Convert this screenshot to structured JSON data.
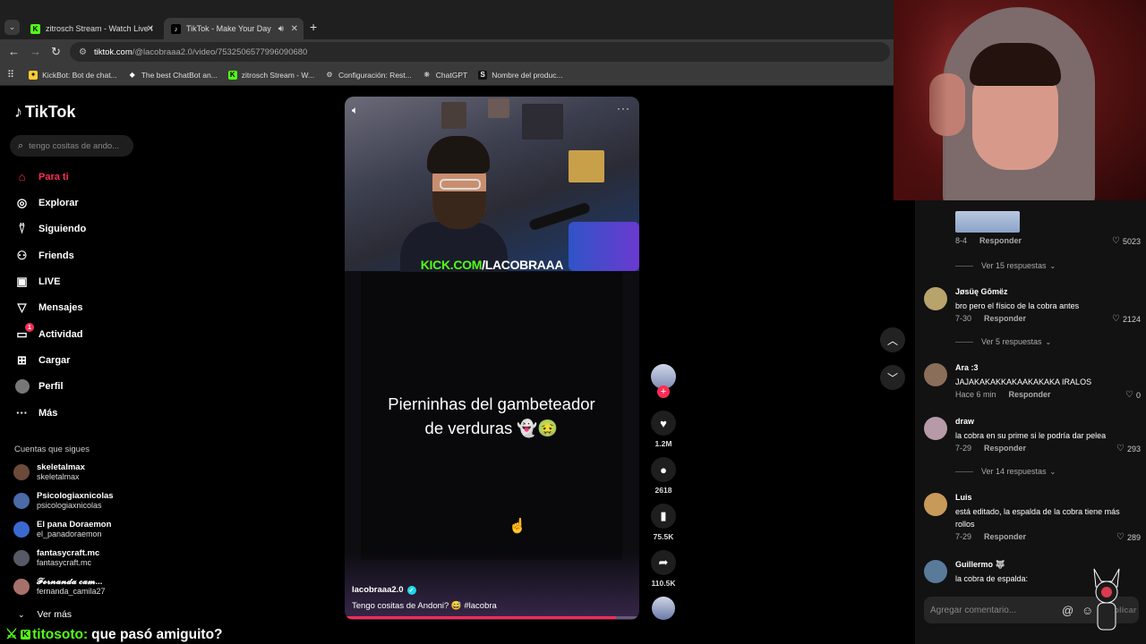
{
  "browser": {
    "tabs": [
      {
        "title": "zitrosch Stream - Watch Live on",
        "favicon": "kick-icon",
        "color": "#53fc18"
      },
      {
        "title": "TikTok - Make Your Day",
        "favicon": "tiktok-icon"
      }
    ],
    "url_host": "tiktok.com",
    "url_path": "/@lacobraaa2.0/video/7532506577996090680",
    "bookmarks": [
      {
        "label": "KickBot: Bot de chat...",
        "icon": "kickbot-icon"
      },
      {
        "label": "The best ChatBot an...",
        "icon": "chatbot-icon"
      },
      {
        "label": "zitrosch Stream - W...",
        "icon": "kick-icon"
      },
      {
        "label": "Configuración: Rest...",
        "icon": "gear-icon"
      },
      {
        "label": "ChatGPT",
        "icon": "chatgpt-icon"
      },
      {
        "label": "Nombre del produc...",
        "icon": "s-icon"
      }
    ]
  },
  "sidebar": {
    "logo": "TikTok",
    "search_placeholder": "tengo cositas de ando...",
    "nav": [
      {
        "label": "Para ti",
        "icon": "home-icon",
        "active": true
      },
      {
        "label": "Explorar",
        "icon": "compass-icon"
      },
      {
        "label": "Siguiendo",
        "icon": "following-icon"
      },
      {
        "label": "Friends",
        "icon": "friends-icon"
      },
      {
        "label": "LIVE",
        "icon": "live-icon"
      },
      {
        "label": "Mensajes",
        "icon": "messages-icon"
      },
      {
        "label": "Actividad",
        "icon": "activity-icon",
        "badge": "1"
      },
      {
        "label": "Cargar",
        "icon": "upload-icon"
      },
      {
        "label": "Perfil",
        "icon": "profile-icon"
      },
      {
        "label": "Más",
        "icon": "more-icon"
      }
    ],
    "following_header": "Cuentas que sigues",
    "following": [
      {
        "name": "skeletalmax",
        "handle": "skeletalmax",
        "color": "#6b4a3a"
      },
      {
        "name": "Psicologiaxnicolas",
        "handle": "psicologiaxnicolas",
        "color": "#4a6aa8"
      },
      {
        "name": "El pana Doraemon",
        "handle": "el_panadoraemon",
        "color": "#3a6ad0"
      },
      {
        "name": "fantasycraft.mc",
        "handle": "fantasycraft.mc",
        "color": "#555a66"
      },
      {
        "name": "𝓕𝓮𝓻𝓷𝓪𝓷𝓭𝓪 𝓬𝓪𝓶...",
        "handle": "fernanda_camila27",
        "color": "#a8706a"
      }
    ],
    "see_more": "Ver más"
  },
  "chat_overlay": {
    "badge": "K",
    "user": "titosoto:",
    "message": "que pasó amiguito?"
  },
  "video": {
    "banner_prefix": "KICK.COM",
    "banner_suffix": "/LACOBRAAA",
    "overlay_text_line1": "Pierninhas del gambeteador",
    "overlay_text_line2": "de verduras 👻🤢",
    "author": "lacobraaa2.0",
    "caption": "Tengo cositas de Andoni? 😅 #lacobra",
    "progress": 0.92,
    "likes": "1.2M",
    "comments": "2618",
    "saves": "75.5K",
    "shares": "110.5K"
  },
  "comments": [
    {
      "name": "",
      "text": "",
      "date": "8-4",
      "reply": "Responder",
      "likes": "5023",
      "replies": "Ver 15 respuestas",
      "color": "#8aa3c9"
    },
    {
      "name": "Jøsüę Gōmëz",
      "text": "bro pero el físico de la cobra antes",
      "date": "7-30",
      "reply": "Responder",
      "likes": "2124",
      "replies": "Ver 5 respuestas",
      "color": "#b8a36a"
    },
    {
      "name": "Ara :3",
      "text": "JAJAKAKAKKAKAAKAKAKA IRALOS",
      "date": "Hace 6 min",
      "reply": "Responder",
      "likes": "0",
      "replies": "",
      "color": "#8a6e5a"
    },
    {
      "name": "draw",
      "text": "la cobra en su prime si le podría dar pelea",
      "date": "7-29",
      "reply": "Responder",
      "likes": "293",
      "replies": "Ver 14 respuestas",
      "color": "#b79aa8"
    },
    {
      "name": "Luis",
      "text": "está editado, la espalda de la cobra tiene más rollos",
      "date": "7-29",
      "reply": "Responder",
      "likes": "289",
      "replies": "",
      "color": "#c89a5a"
    },
    {
      "name": "Guillermo 🐺",
      "text": "la cobra de espalda:",
      "date": "",
      "reply": "",
      "likes": "",
      "replies": "",
      "color": "#5a7a9a"
    }
  ],
  "comment_input_placeholder": "Agregar comentario...",
  "publish_label": "Publicar"
}
